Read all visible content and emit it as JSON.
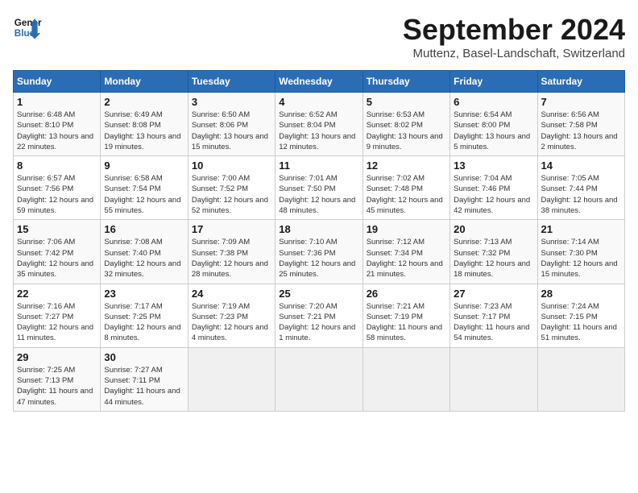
{
  "header": {
    "logo": {
      "line1": "General",
      "line2": "Blue"
    },
    "title": "September 2024",
    "location": "Muttenz, Basel-Landschaft, Switzerland"
  },
  "weekdays": [
    "Sunday",
    "Monday",
    "Tuesday",
    "Wednesday",
    "Thursday",
    "Friday",
    "Saturday"
  ],
  "weeks": [
    [
      {
        "day": "1",
        "sunrise": "Sunrise: 6:48 AM",
        "sunset": "Sunset: 8:10 PM",
        "daylight": "Daylight: 13 hours and 22 minutes."
      },
      {
        "day": "2",
        "sunrise": "Sunrise: 6:49 AM",
        "sunset": "Sunset: 8:08 PM",
        "daylight": "Daylight: 13 hours and 19 minutes."
      },
      {
        "day": "3",
        "sunrise": "Sunrise: 6:50 AM",
        "sunset": "Sunset: 8:06 PM",
        "daylight": "Daylight: 13 hours and 15 minutes."
      },
      {
        "day": "4",
        "sunrise": "Sunrise: 6:52 AM",
        "sunset": "Sunset: 8:04 PM",
        "daylight": "Daylight: 13 hours and 12 minutes."
      },
      {
        "day": "5",
        "sunrise": "Sunrise: 6:53 AM",
        "sunset": "Sunset: 8:02 PM",
        "daylight": "Daylight: 13 hours and 9 minutes."
      },
      {
        "day": "6",
        "sunrise": "Sunrise: 6:54 AM",
        "sunset": "Sunset: 8:00 PM",
        "daylight": "Daylight: 13 hours and 5 minutes."
      },
      {
        "day": "7",
        "sunrise": "Sunrise: 6:56 AM",
        "sunset": "Sunset: 7:58 PM",
        "daylight": "Daylight: 13 hours and 2 minutes."
      }
    ],
    [
      {
        "day": "8",
        "sunrise": "Sunrise: 6:57 AM",
        "sunset": "Sunset: 7:56 PM",
        "daylight": "Daylight: 12 hours and 59 minutes."
      },
      {
        "day": "9",
        "sunrise": "Sunrise: 6:58 AM",
        "sunset": "Sunset: 7:54 PM",
        "daylight": "Daylight: 12 hours and 55 minutes."
      },
      {
        "day": "10",
        "sunrise": "Sunrise: 7:00 AM",
        "sunset": "Sunset: 7:52 PM",
        "daylight": "Daylight: 12 hours and 52 minutes."
      },
      {
        "day": "11",
        "sunrise": "Sunrise: 7:01 AM",
        "sunset": "Sunset: 7:50 PM",
        "daylight": "Daylight: 12 hours and 48 minutes."
      },
      {
        "day": "12",
        "sunrise": "Sunrise: 7:02 AM",
        "sunset": "Sunset: 7:48 PM",
        "daylight": "Daylight: 12 hours and 45 minutes."
      },
      {
        "day": "13",
        "sunrise": "Sunrise: 7:04 AM",
        "sunset": "Sunset: 7:46 PM",
        "daylight": "Daylight: 12 hours and 42 minutes."
      },
      {
        "day": "14",
        "sunrise": "Sunrise: 7:05 AM",
        "sunset": "Sunset: 7:44 PM",
        "daylight": "Daylight: 12 hours and 38 minutes."
      }
    ],
    [
      {
        "day": "15",
        "sunrise": "Sunrise: 7:06 AM",
        "sunset": "Sunset: 7:42 PM",
        "daylight": "Daylight: 12 hours and 35 minutes."
      },
      {
        "day": "16",
        "sunrise": "Sunrise: 7:08 AM",
        "sunset": "Sunset: 7:40 PM",
        "daylight": "Daylight: 12 hours and 32 minutes."
      },
      {
        "day": "17",
        "sunrise": "Sunrise: 7:09 AM",
        "sunset": "Sunset: 7:38 PM",
        "daylight": "Daylight: 12 hours and 28 minutes."
      },
      {
        "day": "18",
        "sunrise": "Sunrise: 7:10 AM",
        "sunset": "Sunset: 7:36 PM",
        "daylight": "Daylight: 12 hours and 25 minutes."
      },
      {
        "day": "19",
        "sunrise": "Sunrise: 7:12 AM",
        "sunset": "Sunset: 7:34 PM",
        "daylight": "Daylight: 12 hours and 21 minutes."
      },
      {
        "day": "20",
        "sunrise": "Sunrise: 7:13 AM",
        "sunset": "Sunset: 7:32 PM",
        "daylight": "Daylight: 12 hours and 18 minutes."
      },
      {
        "day": "21",
        "sunrise": "Sunrise: 7:14 AM",
        "sunset": "Sunset: 7:30 PM",
        "daylight": "Daylight: 12 hours and 15 minutes."
      }
    ],
    [
      {
        "day": "22",
        "sunrise": "Sunrise: 7:16 AM",
        "sunset": "Sunset: 7:27 PM",
        "daylight": "Daylight: 12 hours and 11 minutes."
      },
      {
        "day": "23",
        "sunrise": "Sunrise: 7:17 AM",
        "sunset": "Sunset: 7:25 PM",
        "daylight": "Daylight: 12 hours and 8 minutes."
      },
      {
        "day": "24",
        "sunrise": "Sunrise: 7:19 AM",
        "sunset": "Sunset: 7:23 PM",
        "daylight": "Daylight: 12 hours and 4 minutes."
      },
      {
        "day": "25",
        "sunrise": "Sunrise: 7:20 AM",
        "sunset": "Sunset: 7:21 PM",
        "daylight": "Daylight: 12 hours and 1 minute."
      },
      {
        "day": "26",
        "sunrise": "Sunrise: 7:21 AM",
        "sunset": "Sunset: 7:19 PM",
        "daylight": "Daylight: 11 hours and 58 minutes."
      },
      {
        "day": "27",
        "sunrise": "Sunrise: 7:23 AM",
        "sunset": "Sunset: 7:17 PM",
        "daylight": "Daylight: 11 hours and 54 minutes."
      },
      {
        "day": "28",
        "sunrise": "Sunrise: 7:24 AM",
        "sunset": "Sunset: 7:15 PM",
        "daylight": "Daylight: 11 hours and 51 minutes."
      }
    ],
    [
      {
        "day": "29",
        "sunrise": "Sunrise: 7:25 AM",
        "sunset": "Sunset: 7:13 PM",
        "daylight": "Daylight: 11 hours and 47 minutes."
      },
      {
        "day": "30",
        "sunrise": "Sunrise: 7:27 AM",
        "sunset": "Sunset: 7:11 PM",
        "daylight": "Daylight: 11 hours and 44 minutes."
      },
      {
        "day": "",
        "sunrise": "",
        "sunset": "",
        "daylight": ""
      },
      {
        "day": "",
        "sunrise": "",
        "sunset": "",
        "daylight": ""
      },
      {
        "day": "",
        "sunrise": "",
        "sunset": "",
        "daylight": ""
      },
      {
        "day": "",
        "sunrise": "",
        "sunset": "",
        "daylight": ""
      },
      {
        "day": "",
        "sunrise": "",
        "sunset": "",
        "daylight": ""
      }
    ]
  ]
}
